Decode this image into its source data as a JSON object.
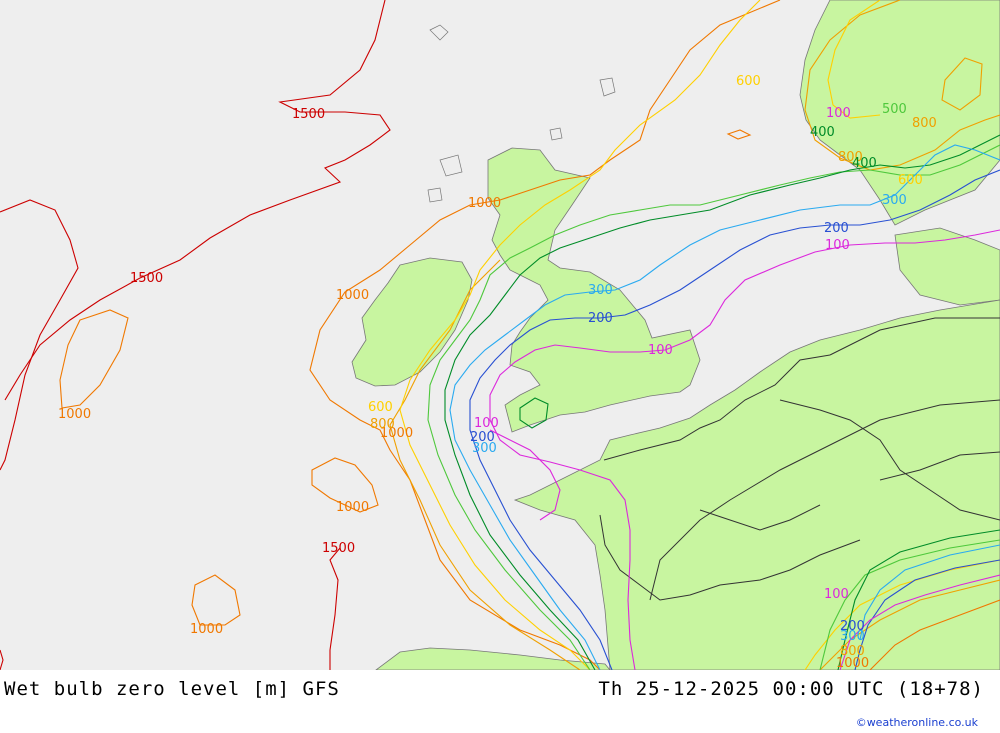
{
  "footer": {
    "title": "Wet bulb zero level [m] GFS",
    "valid_time": "Th 25-12-2025 00:00 UTC (18+78)",
    "credit": "©weatheronline.co.uk"
  },
  "colors": {
    "sea": "#eeeeee",
    "land": "#c8f5a0",
    "border": "#555555",
    "c1500": "#cc0000",
    "c1000": "#f07800",
    "c800": "#f0a000",
    "c600": "#ffd000",
    "c500": "#4ec83c",
    "c400": "#008c28",
    "c300": "#2aaaf0",
    "c200": "#2850d2",
    "c100": "#dc28dc"
  },
  "contour_labels": [
    {
      "text": "1500",
      "level": "c1500"
    },
    {
      "text": "1500",
      "level": "c1500"
    },
    {
      "text": "1500",
      "level": "c1500"
    },
    {
      "text": "1000",
      "level": "c1000"
    },
    {
      "text": "1000",
      "level": "c1000"
    },
    {
      "text": "1000",
      "level": "c1000"
    },
    {
      "text": "1000",
      "level": "c1000"
    },
    {
      "text": "1000",
      "level": "c1000"
    },
    {
      "text": "1000",
      "level": "c1000"
    },
    {
      "text": "1000",
      "level": "c1000"
    },
    {
      "text": "800",
      "level": "c800"
    },
    {
      "text": "800",
      "level": "c800"
    },
    {
      "text": "800",
      "level": "c800"
    },
    {
      "text": "800",
      "level": "c800"
    },
    {
      "text": "600",
      "level": "c600"
    },
    {
      "text": "600",
      "level": "c600"
    },
    {
      "text": "600",
      "level": "c600"
    },
    {
      "text": "500",
      "level": "c500"
    },
    {
      "text": "400",
      "level": "c400"
    },
    {
      "text": "400",
      "level": "c400"
    },
    {
      "text": "300",
      "level": "c300"
    },
    {
      "text": "300",
      "level": "c300"
    },
    {
      "text": "300",
      "level": "c300"
    },
    {
      "text": "300",
      "level": "c300"
    },
    {
      "text": "200",
      "level": "c200"
    },
    {
      "text": "200",
      "level": "c200"
    },
    {
      "text": "200",
      "level": "c200"
    },
    {
      "text": "200",
      "level": "c200"
    },
    {
      "text": "100",
      "level": "c100"
    },
    {
      "text": "100",
      "level": "c100"
    },
    {
      "text": "100",
      "level": "c100"
    },
    {
      "text": "100",
      "level": "c100"
    },
    {
      "text": "100",
      "level": "c100"
    }
  ]
}
